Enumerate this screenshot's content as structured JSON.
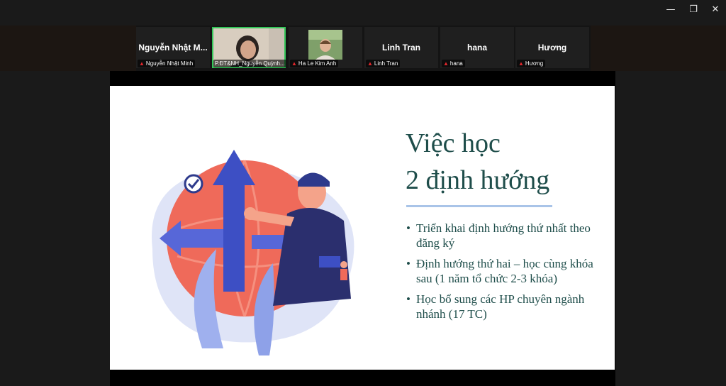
{
  "window": {
    "minimize_icon": "minimize-icon",
    "maximize_icon": "restore-icon",
    "close_icon": "close-icon"
  },
  "participants": [
    {
      "display_name": "Nguyễn Nhật M...",
      "tag": "Nguyễn Nhật Minh",
      "muted": true,
      "video": false
    },
    {
      "display_name": "",
      "tag": "P.ĐT&NH_Nguyễn Quỳnh...",
      "muted": false,
      "video": true,
      "active_speaker": true
    },
    {
      "display_name": "",
      "tag": "Ha Le Kim Anh",
      "muted": true,
      "video": true
    },
    {
      "display_name": "Linh Tran",
      "tag": "Linh Tran",
      "muted": true,
      "video": false
    },
    {
      "display_name": "hana",
      "tag": "hana",
      "muted": true,
      "video": false
    },
    {
      "display_name": "Hương",
      "tag": "Hương",
      "muted": true,
      "video": false
    }
  ],
  "slide": {
    "title_line1": "Việc học",
    "title_line2": "2 định hướng",
    "bullets": [
      "Triển khai định hướng thứ nhất theo đăng ký",
      "Định hướng thứ hai – học cùng khóa sau (1 năm tổ chức 2-3 khóa)",
      "Học bổ sung các HP chuyên ngành nhánh (17 TC)"
    ]
  },
  "colors": {
    "accent_green": "#34c759",
    "mic_muted": "#e0262b",
    "slide_text": "#1e4d4a",
    "slide_rule": "#a9c4e8"
  }
}
